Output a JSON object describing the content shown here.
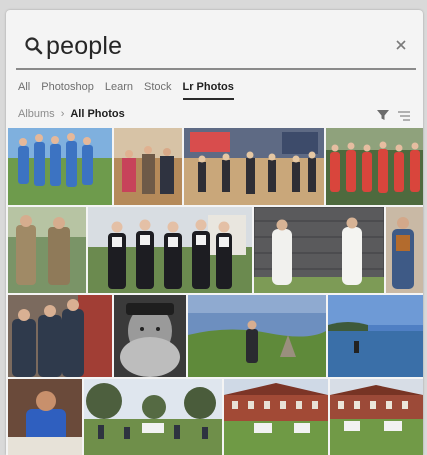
{
  "search": {
    "query": "people",
    "icon": "search-icon",
    "clear_icon": "close-icon"
  },
  "tabs": [
    {
      "label": "All",
      "active": false
    },
    {
      "label": "Photoshop",
      "active": false
    },
    {
      "label": "Learn",
      "active": false
    },
    {
      "label": "Stock",
      "active": false
    },
    {
      "label": "Lr Photos",
      "active": true
    }
  ],
  "breadcrumb": {
    "albums": "Albums",
    "separator": "›",
    "current": "All Photos"
  },
  "toolbar": {
    "filter_icon": "filter-icon",
    "sort_icon": "sort-icon"
  },
  "colors": {
    "panel_bg": "#f4f4f4",
    "text_primary": "#1f1f1f",
    "text_muted": "#6e6e6e",
    "active_underline": "#2a2a2a"
  }
}
